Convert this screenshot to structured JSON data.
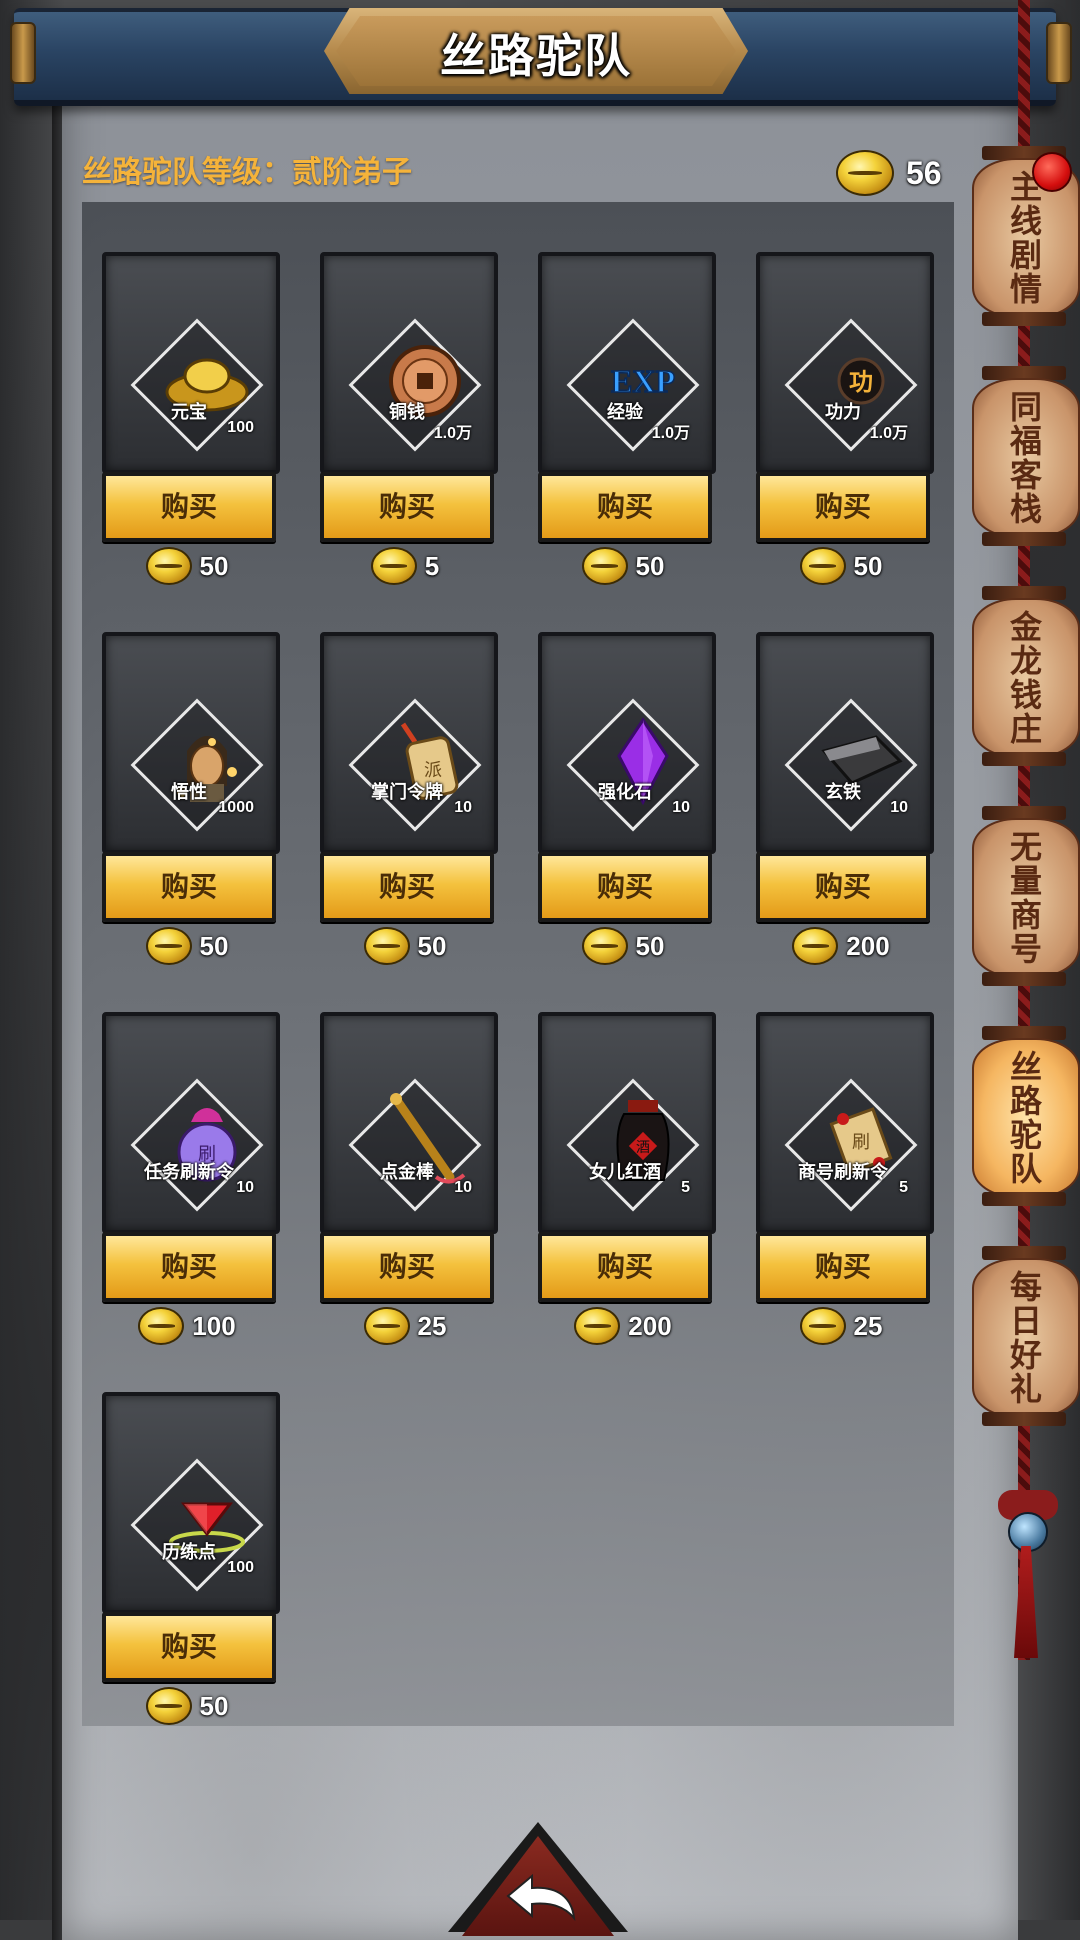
{
  "header": {
    "title": "丝路驼队"
  },
  "status": {
    "rank_label": "丝路驼队等级：贰阶弟子",
    "currency_count": "56"
  },
  "buy_label": "购买",
  "items": [
    {
      "name": "元宝",
      "qty": "100",
      "price": "50",
      "icon": "gold-ingot-icon"
    },
    {
      "name": "铜钱",
      "qty": "1.0万",
      "price": "5",
      "icon": "copper-coin-icon"
    },
    {
      "name": "经验",
      "qty": "1.0万",
      "price": "50",
      "icon": "exp-icon",
      "icon_text": "EXP"
    },
    {
      "name": "功力",
      "qty": "1.0万",
      "price": "50",
      "icon": "power-icon",
      "icon_text": "功"
    },
    {
      "name": "悟性",
      "qty": "1000",
      "price": "50",
      "icon": "insight-icon"
    },
    {
      "name": "掌门令牌",
      "qty": "10",
      "price": "50",
      "icon": "token-icon",
      "icon_text": "派"
    },
    {
      "name": "强化石",
      "qty": "10",
      "price": "50",
      "icon": "purple-crystal-icon"
    },
    {
      "name": "玄铁",
      "qty": "10",
      "price": "200",
      "icon": "dark-iron-icon"
    },
    {
      "name": "任务刷新令",
      "qty": "10",
      "price": "100",
      "icon": "task-refresh-pouch-icon",
      "icon_text": "刷"
    },
    {
      "name": "点金棒",
      "qty": "10",
      "price": "25",
      "icon": "golden-staff-icon"
    },
    {
      "name": "女儿红酒",
      "qty": "5",
      "price": "200",
      "icon": "wine-jar-icon",
      "icon_text": "酒"
    },
    {
      "name": "商号刷新令",
      "qty": "5",
      "price": "25",
      "icon": "shop-refresh-scroll-icon",
      "icon_text": "刷"
    },
    {
      "name": "历练点",
      "qty": "100",
      "price": "50",
      "icon": "red-gem-icon"
    }
  ],
  "side_tabs": [
    {
      "label": "主线剧情",
      "active": false,
      "has_alert": true
    },
    {
      "label": "同福客栈",
      "active": false,
      "has_alert": false
    },
    {
      "label": "金龙钱庄",
      "active": false,
      "has_alert": false
    },
    {
      "label": "无量商号",
      "active": false,
      "has_alert": false
    },
    {
      "label": "丝路驼队",
      "active": true,
      "has_alert": false
    },
    {
      "label": "每日好礼",
      "active": false,
      "has_alert": false
    }
  ],
  "colors": {
    "rank_text": "#f5b33a",
    "buy_button": "#f4c23e",
    "banner": "#2a4463"
  }
}
